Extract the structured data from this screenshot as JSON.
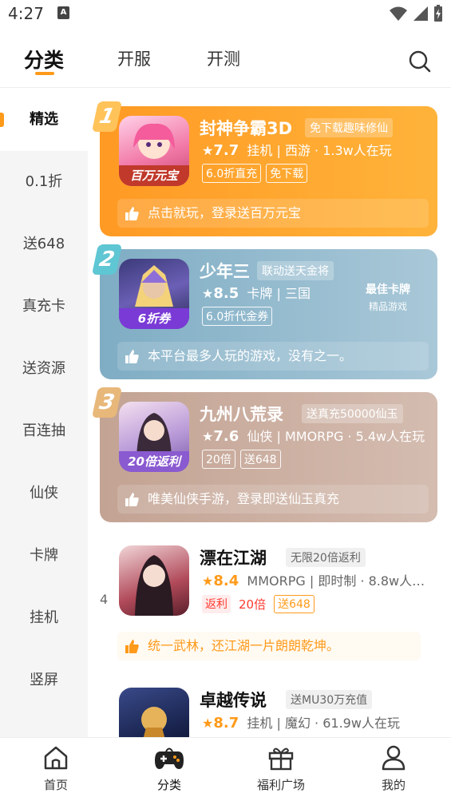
{
  "status_bar": {
    "time": "4:27",
    "sim_label": "A"
  },
  "top_tabs": [
    {
      "label": "分类"
    },
    {
      "label": "开服"
    },
    {
      "label": "开测"
    }
  ],
  "sidebar": {
    "items": [
      {
        "label": "精选"
      },
      {
        "label": "0.1折"
      },
      {
        "label": "送648"
      },
      {
        "label": "真充卡"
      },
      {
        "label": "送资源"
      },
      {
        "label": "百连抽"
      },
      {
        "label": "仙侠"
      },
      {
        "label": "卡牌"
      },
      {
        "label": "挂机"
      },
      {
        "label": "竖屏"
      }
    ]
  },
  "featured": [
    {
      "rank": "1",
      "name": "封神争霸3D",
      "tag": "免下载趣味修仙",
      "score": "7.7",
      "meta": "挂机 | 西游 · 1.3w人在玩",
      "badges": [
        "6.0折直充",
        "免下载"
      ],
      "slogan": "点击就玩，登录送百万元宝",
      "icon_ribbon": "百万元宝",
      "color": "#ffa22a"
    },
    {
      "rank": "2",
      "name": "少年三",
      "tag": "联动送天金将",
      "score": "8.5",
      "meta": "卡牌 | 三国",
      "badges": [
        "6.0折代金券"
      ],
      "slogan": "本平台最多人玩的游戏，没有之一。",
      "icon_ribbon": "6折券",
      "award_title": "最佳卡牌",
      "award_sub": "精品游戏",
      "color": "#8db6cb"
    },
    {
      "rank": "3",
      "name": "九州八荒录",
      "tag": "送真充50000仙玉",
      "score": "7.6",
      "meta": "仙侠 | MMORPG · 5.4w人在玩",
      "badges": [
        "20倍",
        "送648"
      ],
      "slogan": "唯美仙侠手游，登录即送仙玉真充",
      "icon_ribbon": "20倍返利",
      "color": "#c9ab9d"
    }
  ],
  "list": [
    {
      "num": "4",
      "name": "漂在江湖",
      "tag": "无限20倍返利",
      "score": "8.4",
      "meta": "MMORPG | 即时制 · 8.8w人…",
      "badges": [
        "返利",
        "20倍",
        "送648"
      ],
      "slogan": "统一武林，还江湖一片朗朗乾坤。"
    },
    {
      "num": "",
      "name": "卓越传说",
      "tag": "送MU30万充值",
      "score": "8.7",
      "meta": "挂机 | 魔幻 · 61.9w人在玩"
    }
  ],
  "bottom_nav": [
    {
      "label": "首页"
    },
    {
      "label": "分类"
    },
    {
      "label": "福利广场"
    },
    {
      "label": "我的"
    }
  ],
  "colors": {
    "accent": "#ff9a1a",
    "card1": "#ffa22a",
    "card2": "#8db6cb",
    "card3": "#c9ab9d"
  }
}
